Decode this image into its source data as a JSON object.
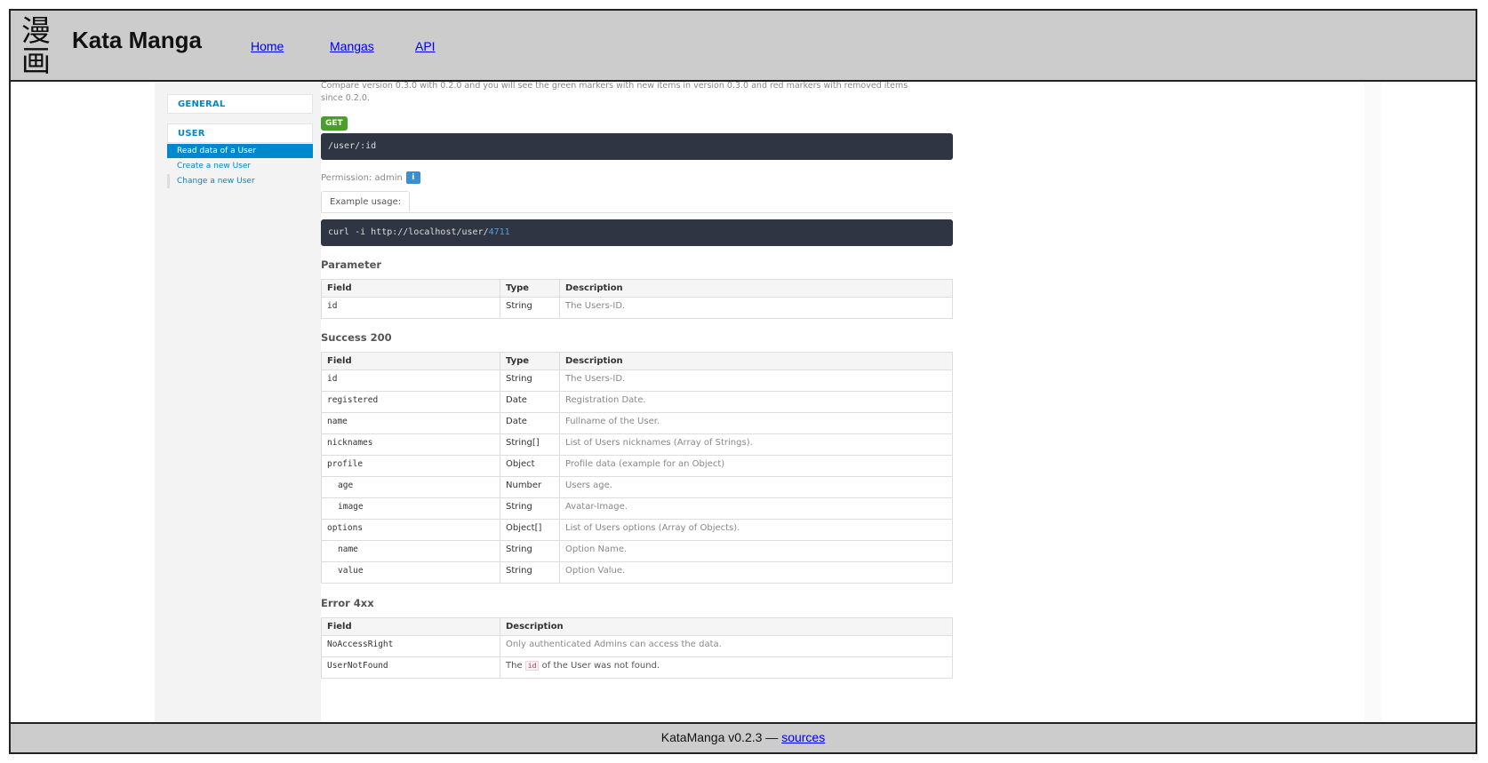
{
  "header": {
    "logo_text": "漫画",
    "title": "Kata Manga",
    "nav": [
      {
        "label": "Home"
      },
      {
        "label": "Mangas"
      },
      {
        "label": "API"
      }
    ]
  },
  "sidebar": {
    "sections": [
      {
        "label": "GENERAL"
      },
      {
        "label": "USER"
      }
    ],
    "items": [
      {
        "label": "Read data of a User",
        "active": true
      },
      {
        "label": "Create a new User",
        "active": false
      },
      {
        "label": "Change a new User",
        "active": false
      }
    ]
  },
  "main": {
    "intro_text": "Compare version 0.3.0 with 0.2.0 and you will see the green markers with new items in version 0.3.0 and red markers with removed items since 0.2.0.",
    "method": "GET",
    "endpoint": "/user/:id",
    "permission_label": "Permission: admin",
    "permission_icon": "info-icon",
    "example_tab": "Example usage:",
    "example_cmd": "curl -i http://localhost/user/",
    "example_id": "4711",
    "parameter": {
      "title": "Parameter",
      "headers": [
        "Field",
        "Type",
        "Description"
      ],
      "rows": [
        {
          "field": "id",
          "type": "String",
          "desc": "The Users-ID."
        }
      ]
    },
    "success": {
      "title": "Success 200",
      "headers": [
        "Field",
        "Type",
        "Description"
      ],
      "rows": [
        {
          "field": "id",
          "type": "String",
          "desc": "The Users-ID."
        },
        {
          "field": "registered",
          "type": "Date",
          "desc": "Registration Date."
        },
        {
          "field": "name",
          "type": "Date",
          "desc": "Fullname of the User."
        },
        {
          "field": "nicknames",
          "type": "String[]",
          "desc": "List of Users nicknames (Array of Strings)."
        },
        {
          "field": "profile",
          "type": "Object",
          "desc": "Profile data (example for an Object)"
        },
        {
          "field": "age",
          "type": "Number",
          "desc": "Users age."
        },
        {
          "field": "image",
          "type": "String",
          "desc": "Avatar-Image."
        },
        {
          "field": "options",
          "type": "Object[]",
          "desc": "List of Users options (Array of Objects)."
        },
        {
          "field": "name",
          "type": "String",
          "desc": "Option Name."
        },
        {
          "field": "value",
          "type": "String",
          "desc": "Option Value."
        }
      ]
    },
    "error": {
      "title": "Error 4xx",
      "headers": [
        "Field",
        "Description"
      ],
      "rows": [
        {
          "field": "NoAccessRight",
          "desc": "Only authenticated Admins can access the data."
        },
        {
          "field": "UserNotFound",
          "desc_pre": "The",
          "desc_code": "id",
          "desc_post": "of the User was not found."
        }
      ]
    }
  },
  "footer": {
    "text": "KataManga v0.2.3 —",
    "link": "sources"
  },
  "colors": {
    "accent": "#0088cc",
    "get_badge": "#4a9e2c",
    "code_bg": "#2f3542",
    "chrome": "#cccccc"
  }
}
